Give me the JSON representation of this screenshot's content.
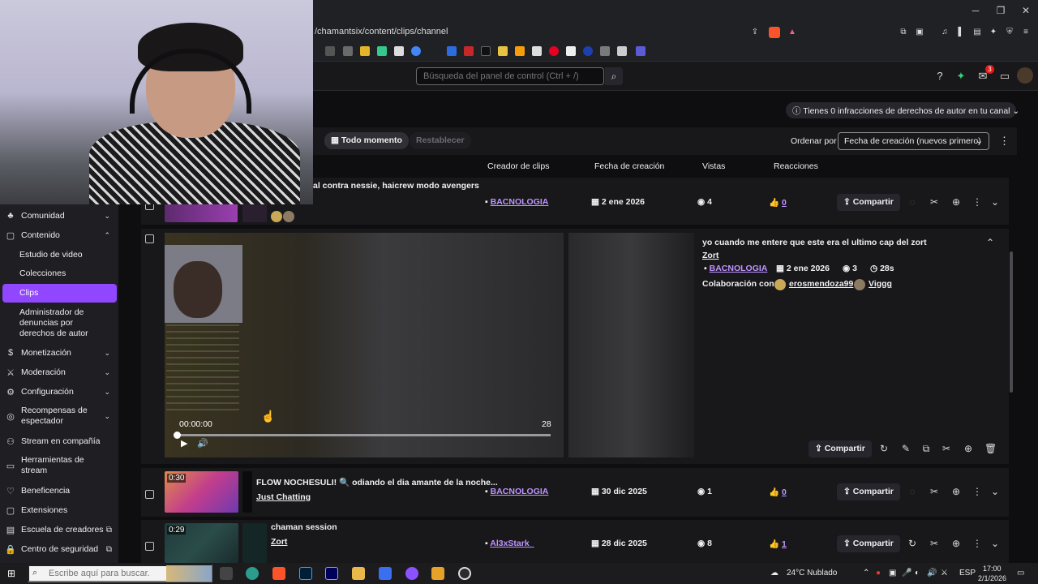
{
  "browser": {
    "url": "/chamantsix/content/clips/channel"
  },
  "topnav": {
    "search_placeholder": "Búsqueda del panel de control (Ctrl + /)",
    "notification_count": "3"
  },
  "sidebar": {
    "items": [
      {
        "label": "Comunidad"
      },
      {
        "label": "Contenido"
      },
      {
        "label": "Estudio de video"
      },
      {
        "label": "Colecciones"
      },
      {
        "label": "Clips"
      },
      {
        "label": "Administrador de denuncias por derechos de autor"
      },
      {
        "label": "Monetización"
      },
      {
        "label": "Moderación"
      },
      {
        "label": "Configuración"
      },
      {
        "label": "Recompensas de espectador"
      },
      {
        "label": "Stream en compañía"
      },
      {
        "label": "Herramientas de stream"
      },
      {
        "label": "Beneficencia"
      },
      {
        "label": "Extensiones"
      },
      {
        "label": "Escuela de creadores"
      },
      {
        "label": "Centro de seguridad"
      }
    ]
  },
  "notice": {
    "copyright": "Tienes 0 infracciones de derechos de autor en tu canal"
  },
  "filters": {
    "period": "Todo momento",
    "reset": "Restablecer",
    "sort_label": "Ordenar por",
    "sort_value": "Fecha de creación (nuevos primero)"
  },
  "columns": {
    "creator": "Creador de clips",
    "date": "Fecha de creación",
    "views": "Vistas",
    "reactions": "Reacciones"
  },
  "rows": [
    {
      "title": "al contra nessie, haicrew modo avengers",
      "creator": "BACNOLOGIA",
      "date": "2 ene 2026",
      "views": "4",
      "reactions": "0",
      "share": "Compartir"
    },
    {
      "title": "yo cuando me entere que este era el ultimo cap del zort",
      "category": "Zort",
      "creator": "BACNOLOGIA",
      "date": "2 ene 2026",
      "views": "3",
      "duration": "28s",
      "collab_label": "Colaboración con:",
      "collab1": "erosmendoza99",
      "collab2": "Viggg",
      "player_time": "00:00:00",
      "player_end": "28",
      "share": "Compartir"
    },
    {
      "duration": "0:30",
      "title": "FLOW NOCHESULI! 🔍 odiando el dia amante de la noche...",
      "category": "Just Chatting",
      "creator": "BACNOLOGIA",
      "date": "30 dic 2025",
      "views": "1",
      "reactions": "0",
      "share": "Compartir"
    },
    {
      "duration": "0:29",
      "title": "chaman session",
      "category": "Zort",
      "creator": "Al3xStark_",
      "date": "28 dic 2025",
      "views": "8",
      "reactions": "1",
      "share": "Compartir"
    }
  ],
  "taskbar": {
    "search_placeholder": "Escribe aquí para buscar.",
    "weather": "24°C  Nublado",
    "lang": "ESP",
    "time": "17:00",
    "date": "2/1/2026"
  }
}
